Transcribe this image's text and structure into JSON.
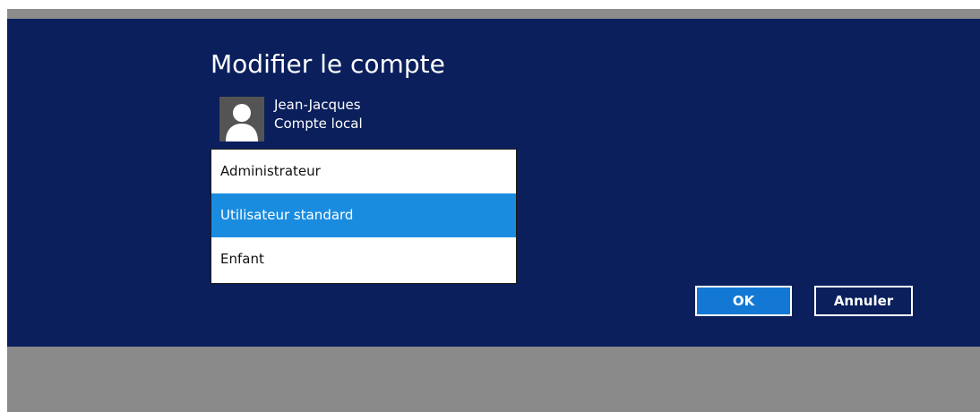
{
  "dialog": {
    "title": "Modifier le compte"
  },
  "user": {
    "name": "Jean-Jacques",
    "account_type": "Compte local",
    "avatar_icon": "user-silhouette-icon"
  },
  "account_type_dropdown": {
    "options": [
      "Administrateur",
      "Utilisateur standard",
      "Enfant"
    ],
    "selected_index": 1
  },
  "buttons": {
    "ok_label": "OK",
    "cancel_label": "Annuler"
  },
  "colors": {
    "panel_background": "#0a1f5c",
    "selection": "#1a8ce0",
    "ok_button": "#1378d4",
    "overlay": "#8a8a8a"
  }
}
